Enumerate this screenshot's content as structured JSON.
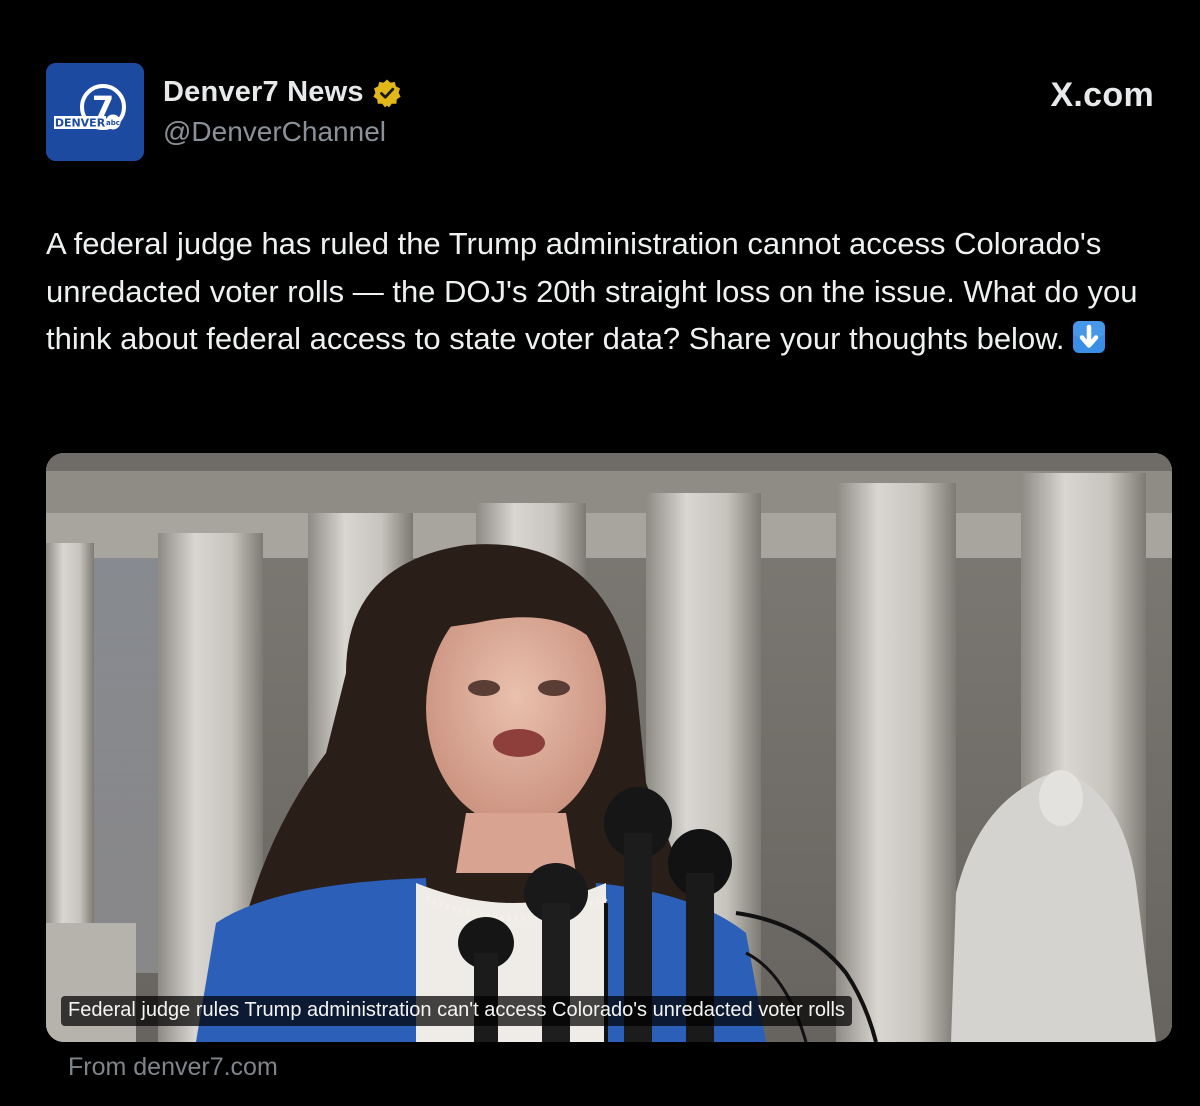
{
  "account": {
    "display_name": "Denver7 News",
    "handle": "@DenverChannel",
    "verified": true,
    "avatar_text": "DENVER",
    "avatar_number": "7",
    "avatar_network": "abc"
  },
  "brand": {
    "source_label": "X.com"
  },
  "post": {
    "text": "A federal judge has ruled the Trump administration cannot access Colorado's unredacted voter rolls — the DOJ's 20th straight loss on the issue. What do you think about federal access to state voter data? Share your thoughts below.",
    "trailing_emoji": "down-arrow-emoji"
  },
  "link_card": {
    "headline": "Federal judge rules Trump administration can't access Colorado's unredacted voter rolls",
    "source": "From denver7.com"
  },
  "colors": {
    "background": "#000000",
    "avatar_blue": "#1c4aa0",
    "badge_gold": "#e2b719",
    "muted_text": "#8b9198"
  }
}
